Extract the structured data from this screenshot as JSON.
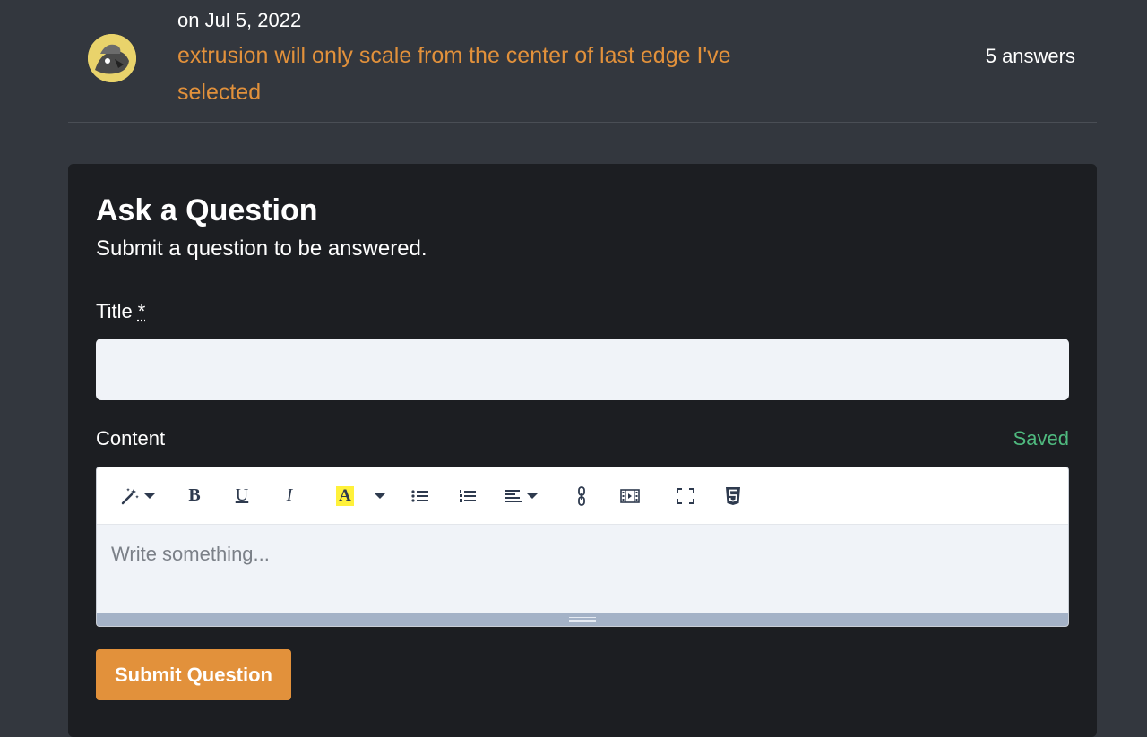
{
  "question": {
    "date": "on Jul 5, 2022",
    "title": "extrusion will only scale from the center of last edge I've selected",
    "answers": "5 answers"
  },
  "ask": {
    "heading": "Ask a Question",
    "subheading": "Submit a question to be answered.",
    "title_label": "Title",
    "required_marker": "*",
    "title_value": "",
    "content_label": "Content",
    "saved_status": "Saved",
    "editor_placeholder": "Write something...",
    "submit_label": "Submit Question"
  },
  "toolbar": {
    "bold": "B",
    "underline": "U",
    "italic": "I",
    "highlight": "A"
  },
  "colors": {
    "accent": "#e2913b",
    "saved": "#4fba7f",
    "card_bg": "#1c1e22",
    "page_bg": "#33373e"
  },
  "icons": [
    "avatar",
    "magic-wand-icon",
    "highlight-icon",
    "bullet-list-icon",
    "numbered-list-icon",
    "align-icon",
    "link-icon",
    "video-icon",
    "fullscreen-icon",
    "html5-icon"
  ]
}
